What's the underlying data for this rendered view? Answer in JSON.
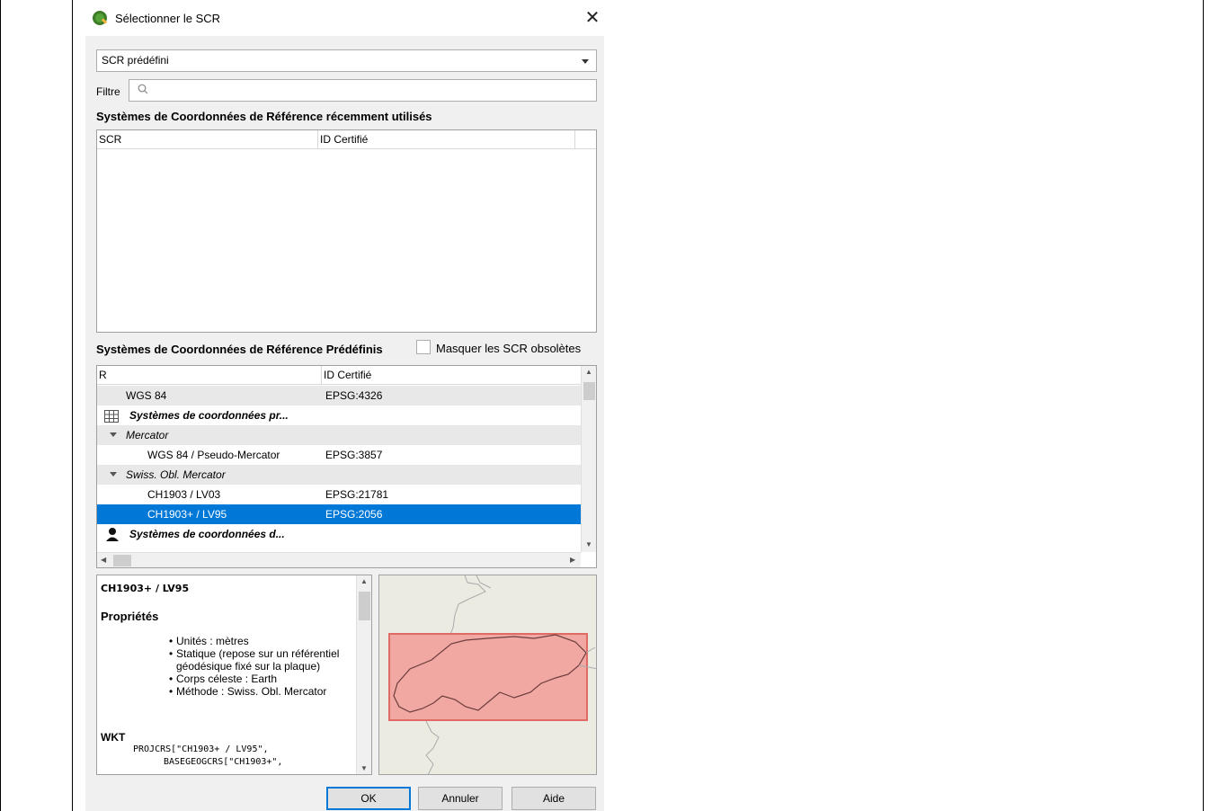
{
  "window": {
    "title": "Sélectionner le SCR",
    "close_glyph": "✕"
  },
  "combo": {
    "value": "SCR prédéfini"
  },
  "filter": {
    "label": "Filtre",
    "value": ""
  },
  "recent": {
    "title": "Systèmes de Coordonnées de Référence récemment utilisés",
    "columns": [
      "SCR",
      "ID Certifié"
    ]
  },
  "predefined": {
    "title": "Systèmes de Coordonnées de Référence Prédéfinis",
    "hide_deprecated_label": "Masquer les SCR obsolètes",
    "hide_deprecated_checked": false,
    "columns": [
      "R",
      "ID Certifié"
    ],
    "rows": [
      {
        "name": "WGS 84",
        "id": "EPSG:4326"
      },
      {
        "name": "Systèmes de coordonnées pr...",
        "id": ""
      },
      {
        "name": "Mercator",
        "id": ""
      },
      {
        "name": "WGS 84 / Pseudo-Mercator",
        "id": "EPSG:3857"
      },
      {
        "name": "Swiss. Obl. Mercator",
        "id": ""
      },
      {
        "name": "CH1903 / LV03",
        "id": "EPSG:21781"
      },
      {
        "name": "CH1903+ / LV95",
        "id": "EPSG:2056"
      },
      {
        "name": "Systèmes de coordonnées d...",
        "id": ""
      }
    ]
  },
  "properties": {
    "crs_name": "CH1903+ / LV95",
    "heading": "Propriétés",
    "items": [
      "Unités : mètres",
      "Statique (repose sur un référentiel géodésique fixé sur la plaque)",
      "Corps céleste : Earth",
      "Méthode : Swiss. Obl. Mercator"
    ],
    "wkt_heading": "WKT",
    "wkt_lines": [
      "PROJCRS[\"CH1903+ / LV95\",",
      "BASEGEOGCRS[\"CH1903+\","
    ]
  },
  "buttons": {
    "ok": "OK",
    "cancel": "Annuler",
    "help": "Aide"
  },
  "colors": {
    "selection": "#0078d7",
    "extent_fill": "#f2a8a2",
    "extent_stroke": "#e06a64"
  }
}
